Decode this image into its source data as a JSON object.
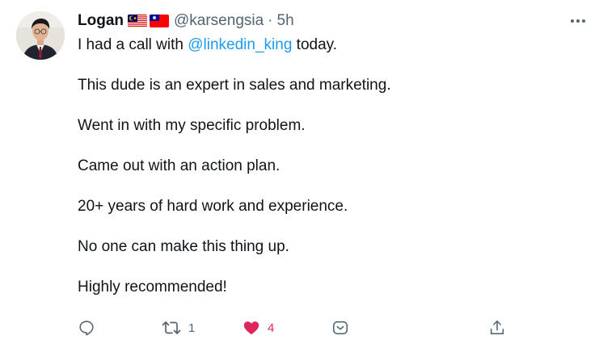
{
  "tweet": {
    "author": {
      "name": "Logan",
      "flags": [
        "malaysia-flag",
        "taiwan-flag"
      ],
      "handle": "@karsengsia",
      "separator": "·",
      "time": "5h"
    },
    "lines": {
      "line1_before": "I had a call with ",
      "mention": "@linkedin_king",
      "line1_after": " today.",
      "line2": "This dude is an expert in sales and marketing.",
      "line3": "Went in with my specific problem.",
      "line4": "Came out with an action plan.",
      "line5": "20+ years of hard work and experience.",
      "line6": "No one can make this thing up.",
      "line7": "Highly recommended!"
    },
    "actions": {
      "reply_icon": "reply-icon",
      "retweet_icon": "retweet-icon",
      "retweet_count": "1",
      "like_icon": "heart-icon",
      "like_count": "4",
      "share_icon": "share-icon",
      "upload_icon": "upload-icon"
    },
    "more_icon": "more-icon"
  },
  "colors": {
    "text": "#0f1419",
    "muted": "#536471",
    "link": "#1d9bf0",
    "like": "#e0245e"
  }
}
